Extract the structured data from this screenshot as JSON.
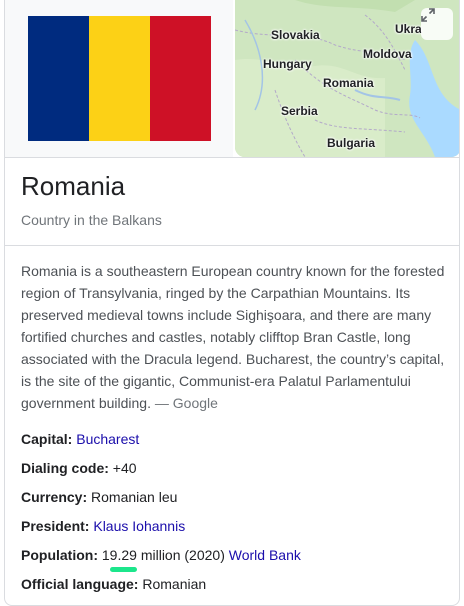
{
  "media": {
    "flag_colors": [
      "#002b7f",
      "#fcd116",
      "#ce1126"
    ],
    "map_labels": {
      "slovakia": "Slovakia",
      "ukraine": "Ukra",
      "hungary": "Hungary",
      "moldova": "Moldova",
      "romania": "Romania",
      "serbia": "Serbia",
      "bulgaria": "Bulgaria"
    },
    "expand_icon": "expand-icon"
  },
  "header": {
    "title": "Romania",
    "subtitle": "Country in the Balkans"
  },
  "description": {
    "text": "Romania is a southeastern European country known for the forested region of Transylvania, ringed by the Carpathian Mountains. Its preserved medieval towns include Sighişoara, and there are many fortified churches and castles, notably clifftop Bran Castle, long associated with the Dracula legend. Bucharest, the country’s capital, is the site of the gigantic, Communist-era Palatul Parlamentului government building.",
    "source": " — Google"
  },
  "facts": {
    "capital": {
      "label": "Capital:",
      "value": "Bucharest"
    },
    "dialing": {
      "label": "Dialing code:",
      "value": " +40"
    },
    "currency": {
      "label": "Currency:",
      "value": " Romanian leu"
    },
    "president": {
      "label": "President:",
      "value": "Klaus Iohannis"
    },
    "population": {
      "label": "Population:",
      "value": "19.29",
      "suffix": " million (2020) ",
      "source": "World Bank"
    },
    "language": {
      "label": "Official language:",
      "value": " Romanian"
    }
  },
  "colors": {
    "link": "#1a0dab",
    "highlight": "#1ce68c"
  }
}
